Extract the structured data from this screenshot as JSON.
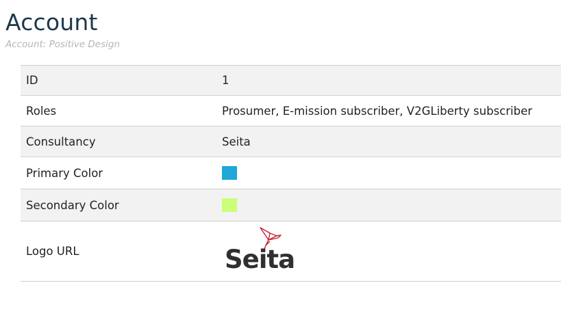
{
  "header": {
    "title": "Account",
    "subtitle": "Account: Positive Design"
  },
  "details": {
    "id": {
      "label": "ID",
      "value": "1"
    },
    "roles": {
      "label": "Roles",
      "value": "Prosumer, E-mission subscriber, V2GLiberty subscriber"
    },
    "consultancy": {
      "label": "Consultancy",
      "value": "Seita"
    },
    "primary_color": {
      "label": "Primary Color",
      "value": "#1ea7d8"
    },
    "secondary_color": {
      "label": "Secondary Color",
      "value": "#ccff77"
    },
    "logo_url": {
      "label": "Logo URL",
      "logo_text": "Seita"
    }
  },
  "colors": {
    "logo_bird": "#c8202f"
  }
}
